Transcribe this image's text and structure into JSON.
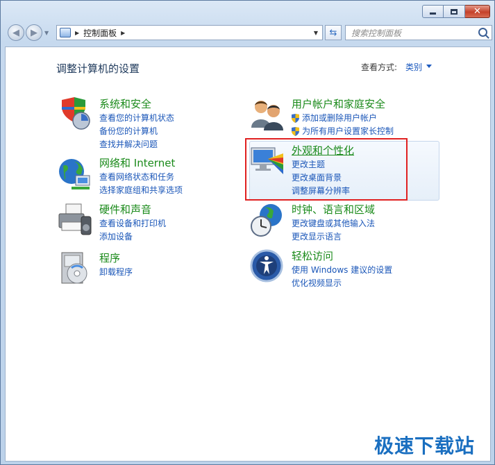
{
  "window": {
    "caption": {
      "minimize": "",
      "maximize": "",
      "close": "✕"
    }
  },
  "address_bar": {
    "breadcrumb": [
      "控制面板"
    ]
  },
  "search": {
    "placeholder": "搜索控制面板"
  },
  "content": {
    "title": "调整计算机的设置",
    "view_by_label": "查看方式:",
    "view_by_value": "类别"
  },
  "categories": [
    {
      "title": "系统和安全",
      "icon": "system-security-icon",
      "links": [
        "查看您的计算机状态",
        "备份您的计算机",
        "查找并解决问题"
      ]
    },
    {
      "title": "网络和 Internet",
      "icon": "network-internet-icon",
      "links": [
        "查看网络状态和任务",
        "选择家庭组和共享选项"
      ]
    },
    {
      "title": "硬件和声音",
      "icon": "hardware-sound-icon",
      "links": [
        "查看设备和打印机",
        "添加设备"
      ]
    },
    {
      "title": "程序",
      "icon": "programs-icon",
      "links": [
        "卸载程序"
      ]
    },
    {
      "title": "用户帐户和家庭安全",
      "icon": "user-accounts-icon",
      "links": [
        "添加或删除用户帐户",
        "为所有用户设置家长控制"
      ]
    },
    {
      "title": "外观和个性化",
      "icon": "appearance-icon",
      "links": [
        "更改主题",
        "更改桌面背景",
        "调整屏幕分辨率"
      ]
    },
    {
      "title": "时钟、语言和区域",
      "icon": "clock-language-icon",
      "links": [
        "更改键盘或其他输入法",
        "更改显示语言"
      ]
    },
    {
      "title": "轻松访问",
      "icon": "ease-of-access-icon",
      "links": [
        "使用 Windows 建议的设置",
        "优化视频显示"
      ]
    }
  ],
  "watermark": "极速下载站"
}
